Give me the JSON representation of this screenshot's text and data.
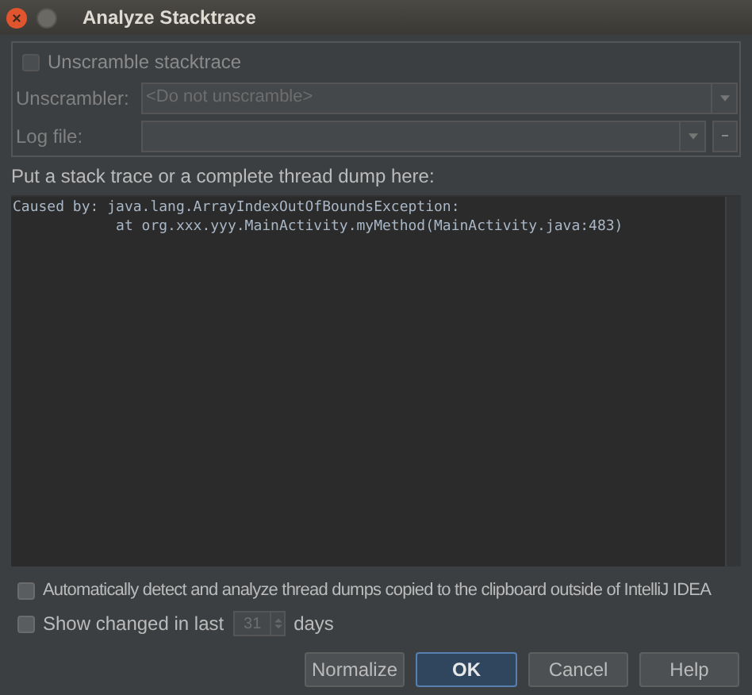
{
  "window": {
    "title": "Analyze Stacktrace"
  },
  "unscramble": {
    "label": "Unscramble stacktrace",
    "checked": false
  },
  "unscrambler": {
    "label": "Unscrambler:",
    "value": "<Do not unscramble>",
    "disabled": true
  },
  "log_file": {
    "label": "Log file:",
    "disabled": true
  },
  "prompt": "Put a stack trace or a complete thread dump here:",
  "stacktrace": [
    "Caused by: java.lang.ArrayIndexOutOfBoundsException:",
    "            at org.xxx.yyy.MainActivity.myMethod(MainActivity.java:483)"
  ],
  "options": [
    {
      "kind": "check",
      "label": "Automatically detect and analyze thread dumps copied to the clipboard outside of IntelliJ IDEA",
      "checked": false
    },
    {
      "kind": "days",
      "label": "Show changed in last",
      "value": "31",
      "suffix": "days",
      "checked": false
    }
  ],
  "buttons": [
    {
      "label": "Normalize",
      "default": false
    },
    {
      "label": "OK",
      "default": true
    },
    {
      "label": "Cancel",
      "default": false
    },
    {
      "label": "Help",
      "default": false
    }
  ]
}
